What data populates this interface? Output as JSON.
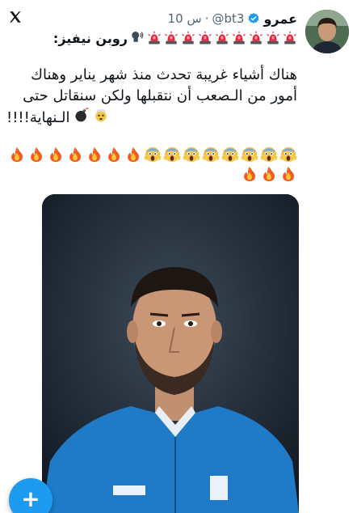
{
  "app": {
    "logo_icon": "x-logo-icon"
  },
  "tweet": {
    "author_name": "عمرو",
    "handle": "@bt3",
    "time": "10 س",
    "verified": true,
    "quote_prefix": "روبن نيفيز:",
    "siren_count": 9,
    "body_line1": "هناك أشياء غريبة تحدث منذ شهر يناير وهناك",
    "body_line2": "أمور من الـصعب أن نتقبلها ولكن سنقاتل حتى",
    "body_line3": "الـنهاية!!!!",
    "emoji_sequence": [
      "scream",
      "scream",
      "scream",
      "scream",
      "scream",
      "scream",
      "scream",
      "scream",
      "fire",
      "fire",
      "fire",
      "fire",
      "fire",
      "fire",
      "fire",
      "fire",
      "fire",
      "fire"
    ]
  },
  "colors": {
    "accent": "#1d9bf0",
    "text": "#0f1419",
    "muted": "#536471"
  },
  "compose": {
    "label": "+"
  }
}
